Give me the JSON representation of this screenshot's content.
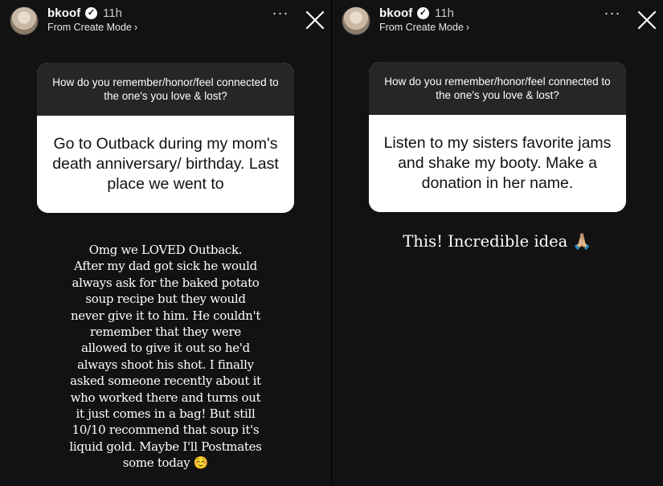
{
  "stories": [
    {
      "username": "bkoof",
      "verified_badge": "✓",
      "time": "11h",
      "subtitle": "From Create Mode",
      "subtitle_chevron": "›",
      "more_icon": "···",
      "question": "How do you remember/honor/feel connected to the one's you love & lost?",
      "answer": "Go to Outback during my mom's death anniversary/ birthday. Last place we went to",
      "reply_lines": [
        "Omg we LOVED Outback.",
        "After my dad got sick he would",
        "always ask for the baked potato",
        "soup recipe but they would",
        "never give it to him. He couldn't",
        "remember that they were",
        "allowed to give it out so he'd",
        "always shoot his shot. I finally",
        "asked someone recently about it",
        "who worked there and turns out",
        "it just comes in a bag! But still",
        "10/10 recommend that soup it's",
        "liquid gold. Maybe I'll Postmates",
        "some today ☺️"
      ]
    },
    {
      "username": "bkoof",
      "verified_badge": "✓",
      "time": "11h",
      "subtitle": "From Create Mode",
      "subtitle_chevron": "›",
      "more_icon": "···",
      "question": "How do you remember/honor/feel connected to the one's you love & lost?",
      "answer": "Listen to my sisters favorite jams and shake my booty. Make a donation in her name.",
      "reply": "This! Incredible idea 🙏🏼"
    }
  ]
}
